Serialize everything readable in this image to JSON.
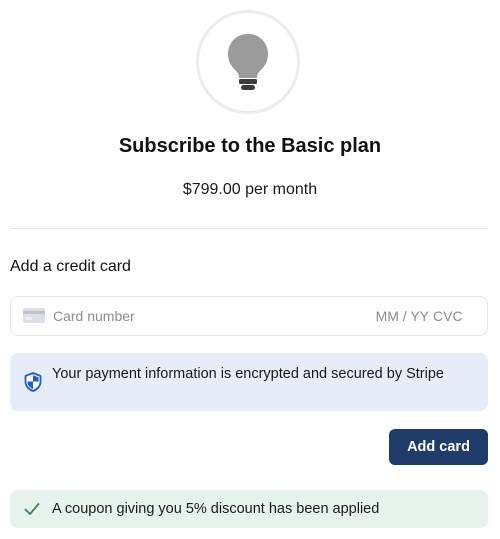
{
  "plan": {
    "icon": "lightbulb-icon",
    "title": "Subscribe to the Basic plan",
    "price": "$799.00 per month"
  },
  "payment": {
    "section_title": "Add a credit card",
    "card_icon": "credit-card-icon",
    "card_number_placeholder": "Card number",
    "expiry_placeholder": "MM / YY",
    "cvc_placeholder": "CVC"
  },
  "secure_notice": {
    "icon": "shield-icon",
    "text": "Your payment information is encrypted and secured by Stripe"
  },
  "actions": {
    "add_card_label": "Add card"
  },
  "coupon_notice": {
    "icon": "check-icon",
    "text": "A coupon giving you 5% discount has been applied"
  },
  "colors": {
    "primary_button": "#1f3c6b",
    "info_background": "#e6ecf8",
    "success_background": "#e5f3ec",
    "success_check": "#2f8a52",
    "shield": "#1f5bd1"
  }
}
